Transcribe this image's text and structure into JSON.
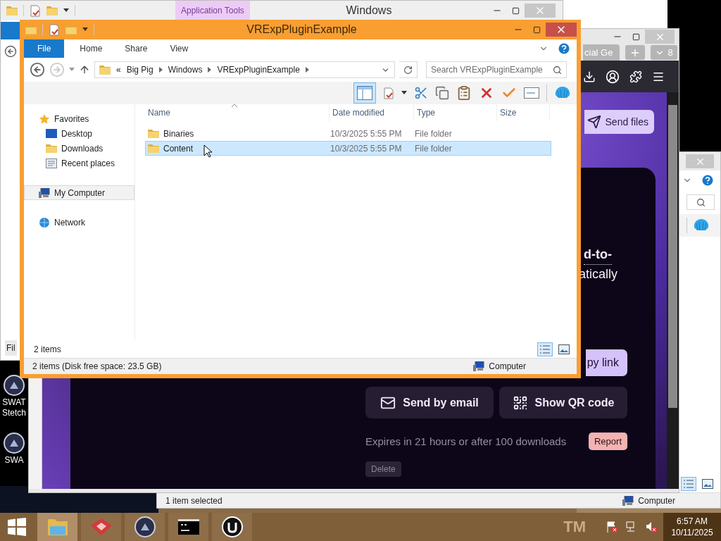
{
  "back_window": {
    "title": "Windows",
    "context_tab": "Application Tools",
    "footer_label": "Fil"
  },
  "right_window": {
    "status_text": "1 item selected",
    "status_location": "Computer"
  },
  "browser": {
    "tabs": [
      {
        "label": "cial Ge"
      }
    ],
    "tab_overflow": "8",
    "send_files": "Send files",
    "card": {
      "lines": [
        {
          "kind": "link",
          "text": "d-to-"
        },
        {
          "kind": "text",
          "text": "atically"
        }
      ],
      "copy_link": "py link",
      "actions": [
        {
          "kind": "email",
          "label": "Send by email"
        },
        {
          "kind": "qr",
          "label": "Show QR code"
        }
      ],
      "expiry": "Expires in 21 hours or after 100 downloads",
      "report": "Report",
      "delete": "Delete"
    }
  },
  "explorer": {
    "title": "VRExpPluginExample",
    "ribbon_tabs": [
      {
        "kind": "file",
        "label": "File"
      },
      {
        "kind": "tab",
        "label": "Home"
      },
      {
        "kind": "tab",
        "label": "Share"
      },
      {
        "kind": "tab",
        "label": "View"
      }
    ],
    "path_overflow": "«",
    "path": [
      "Big Pig",
      "Windows",
      "VRExpPluginExample"
    ],
    "search": {
      "placeholder": "Search VRExpPluginExample"
    },
    "nav": [
      {
        "kind": "favorites",
        "label": "Favorites",
        "selected": false,
        "children": [
          {
            "kind": "desktop",
            "label": "Desktop",
            "selected": false
          },
          {
            "kind": "downloads",
            "label": "Downloads",
            "selected": false
          },
          {
            "kind": "recent",
            "label": "Recent places",
            "selected": false
          }
        ]
      },
      {
        "kind": "computer",
        "label": "My Computer",
        "selected": true
      },
      {
        "kind": "network",
        "label": "Network",
        "selected": false
      }
    ],
    "columns": [
      "Name",
      "Date modified",
      "Type",
      "Size"
    ],
    "rows": [
      {
        "name": "Binaries",
        "date": "10/3/2025 5:55 PM",
        "type": "File folder",
        "selected": false
      },
      {
        "name": "Content",
        "date": "10/3/2025 5:55 PM",
        "type": "File folder",
        "selected": true
      }
    ],
    "item_count": "2 items",
    "status": "2 items (Disk free space: 23.5 GB)",
    "status_location": "Computer"
  },
  "desktop": {
    "icons": [
      {
        "label": "SWAT Stetch"
      },
      {
        "label": "SWA"
      }
    ],
    "wallpaper_text": "TM"
  },
  "taskbar": {
    "apps": [
      {
        "kind": "explorer",
        "selected": true
      },
      {
        "kind": "red-app",
        "selected": false
      },
      {
        "kind": "game",
        "selected": false
      },
      {
        "kind": "terminal",
        "selected": false
      },
      {
        "kind": "unreal",
        "selected": false
      }
    ],
    "tray": [
      {
        "kind": "flag"
      },
      {
        "kind": "network"
      },
      {
        "kind": "volume"
      }
    ],
    "time": "6:57 AM",
    "date": "10/11/2025"
  }
}
